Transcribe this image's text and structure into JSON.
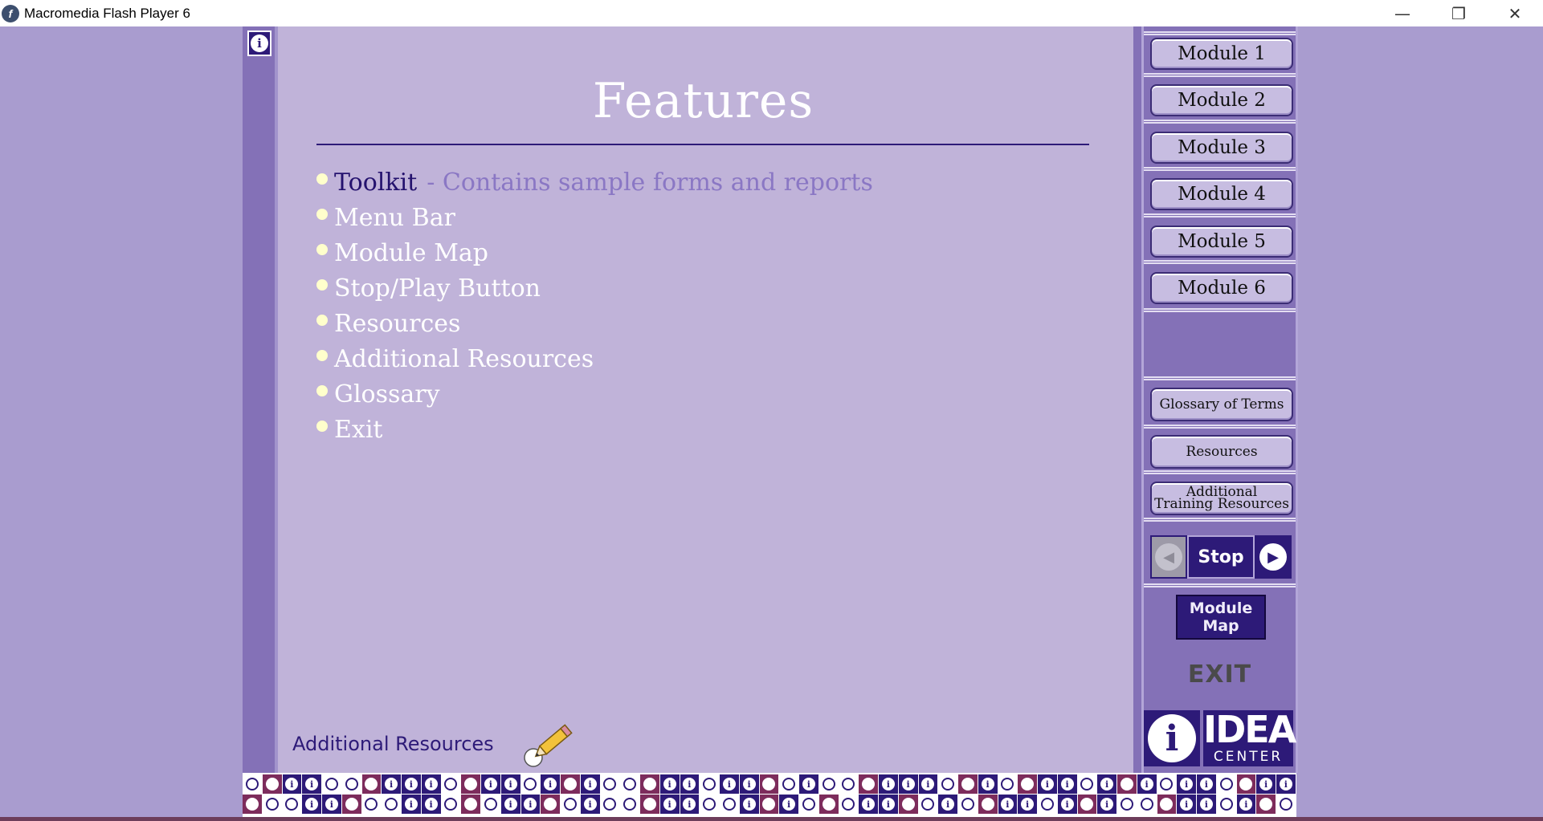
{
  "window": {
    "title": "Macromedia Flash Player 6",
    "app_icon": "f",
    "minimize_glyph": "—",
    "restore_glyph": "❐",
    "close_glyph": "✕"
  },
  "page": {
    "title": "Features",
    "features": [
      {
        "label": "Toolkit",
        "desc": "- Contains sample forms and reports",
        "active": true
      },
      {
        "label": "Menu Bar"
      },
      {
        "label": "Module Map"
      },
      {
        "label": "Stop/Play Button"
      },
      {
        "label": "Resources"
      },
      {
        "label": "Additional Resources"
      },
      {
        "label": "Glossary"
      },
      {
        "label": "Exit"
      }
    ],
    "bottom_label": "Additional Resources"
  },
  "nav": {
    "modules": [
      "Module 1",
      "Module 2",
      "Module 3",
      "Module 4",
      "Module 5",
      "Module 6"
    ],
    "glossary": "Glossary of Terms",
    "resources": "Resources",
    "additional_line1": "Additional",
    "additional_line2": "Training Resources",
    "stop": "Stop",
    "prev_glyph": "◀",
    "next_glyph": "▶",
    "map_line1": "Module",
    "map_line2": "Map",
    "exit": "EXIT",
    "info_glyph": "i",
    "logo_word1": "IDEA",
    "logo_word2": "CENTER"
  },
  "colors": {
    "accent": "#2d1a78",
    "panel": "#8471b7",
    "stage": "#c0b3d9",
    "bullet": "#ffffcc"
  },
  "icons": [
    "info-icon",
    "pencil-icon",
    "prev-arrow-icon",
    "next-arrow-icon"
  ]
}
